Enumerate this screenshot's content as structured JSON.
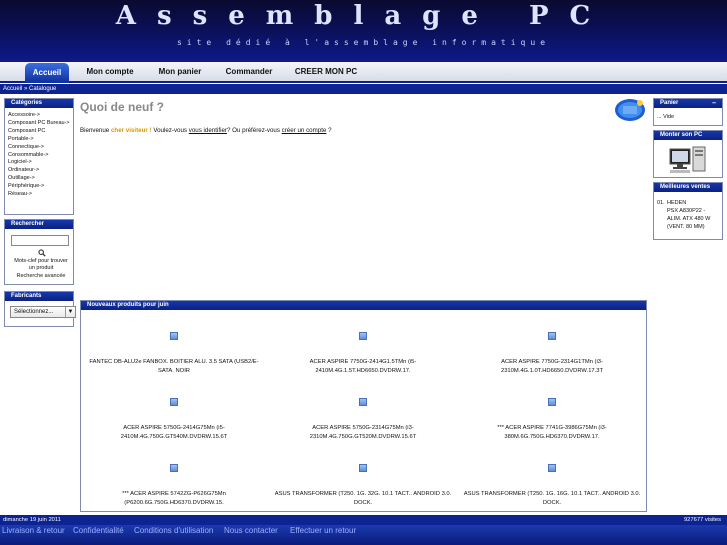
{
  "header": {
    "logo": "Assemblage PC",
    "tagline": "site dédié à l'assemblage informatique"
  },
  "nav": [
    {
      "label": "Accueil"
    },
    {
      "label": "Mon compte"
    },
    {
      "label": "Mon panier"
    },
    {
      "label": "Commander"
    },
    {
      "label": "CREER MON PC"
    }
  ],
  "breadcrumb": "Accueil » Catalogue",
  "categories": {
    "title": "Catégories",
    "items": [
      "Accessoire->",
      "Composant PC Bureau->",
      "Composant PC",
      "Portable->",
      "Connectique->",
      "Consommable->",
      "Logiciel->",
      "Ordinateur->",
      "Outillage->",
      "Périphérique->",
      "Réseau->"
    ]
  },
  "search": {
    "title": "Rechercher",
    "hint_line1": "Mots-clef pour trouver",
    "hint_line2": "un produit",
    "advanced": "Recherche avancée"
  },
  "manufacturers": {
    "title": "Fabricants",
    "selected": "Sélectionnez..."
  },
  "main": {
    "title": "Quoi de neuf ?",
    "welcome_prefix": "Bienvenue",
    "welcome_visitor": "cher visiteur !",
    "welcome_mid": "Voulez-vous",
    "welcome_login": "vous identifier",
    "welcome_mid2": "? Ou préférez-vous",
    "welcome_create": "créer un compte",
    "welcome_end": "?"
  },
  "products": {
    "title": "Nouveaux produits pour juin",
    "items": [
      {
        "line1": "FANTEC DB-ALU2e FANBOX. BOITIER ALU. 3.5 SATA (USB2/E-",
        "line2": "SATA. NOIR"
      },
      {
        "line1": "ACER ASPIRE 7750G-2414G1.5TMn (i5-",
        "line2": "2410M.4G.1.5T.HD6650.DVDRW.17."
      },
      {
        "line1": "ACER ASPIRE 7750G-2314G1TMn (i3-",
        "line2": "2310M.4G.1.0T.HD6650.DVDRW.17.3T"
      },
      {
        "line1": "ACER ASPIRE 5750G-2414G75Mn (i5-",
        "line2": "2410M.4G.750G.GT540M.DVDRW.15.6T"
      },
      {
        "line1": "ACER ASPIRE 5750G-2314G75Mn (i3-",
        "line2": "2310M.4G.750G.GT520M.DVDRW.15.6T"
      },
      {
        "line1": "*** ACER ASPIRE 7741G-3986G75Mn (i3-",
        "line2": "380M.6G.750G.HD6370.DVDRW.17."
      },
      {
        "line1": "*** ACER ASPIRE 5742ZG-P626G75Mn",
        "line2": "(P6200.6G.750G.HD6370.DVDRW.15."
      },
      {
        "line1": "ASUS TRANSFORMER (T250. 1G. 32G. 10.1 TACT.. ANDROID 3.0.",
        "line2": "DOCK."
      },
      {
        "line1": "ASUS TRANSFORMER (T250. 1G. 16G. 10.1 TACT.. ANDROID 3.0.",
        "line2": "DOCK."
      }
    ]
  },
  "cart": {
    "title": "Panier",
    "toggle": "–",
    "content": "... Vide"
  },
  "build": {
    "title": "Monter son PC"
  },
  "bestsellers": {
    "title": "Meilleures ventes",
    "index": "01.",
    "lines": [
      "HEDEN",
      "PSX A830P22 -",
      "ALIM. ATX 480 W",
      "(VENT. 80 MM)"
    ]
  },
  "footer": {
    "date": "dimanche 19 juin 2011",
    "visits": "927677 visites",
    "links": [
      "Livraison & retour",
      "Confidentialité",
      "Conditions d'utilisation",
      "Nous contacter",
      "Effectuer un retour"
    ]
  },
  "colors": {
    "navy": "#0d2391",
    "accent_yellow": "#d69a00"
  }
}
